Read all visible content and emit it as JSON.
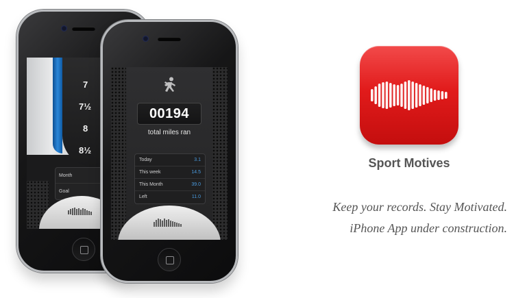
{
  "app": {
    "name": "Sport Motives",
    "tagline_1": "Keep your records. Stay Motivated.",
    "tagline_2": "iPhone App under construction.",
    "icon": "sound-wave-icon",
    "accent": "#e11b1b"
  },
  "back_phone": {
    "ruler": [
      "7",
      "7½",
      "8",
      "8½"
    ],
    "table": [
      {
        "label": "Month"
      },
      {
        "label": "Goal"
      }
    ]
  },
  "front_phone": {
    "icon": "runner-icon",
    "counter": "00194",
    "counter_label": "total miles ran",
    "stats": [
      {
        "label": "Today",
        "value": "3.1"
      },
      {
        "label": "This week",
        "value": "14.5"
      },
      {
        "label": "This Month",
        "value": "39.0"
      },
      {
        "label": "Left",
        "value": "11.0"
      }
    ],
    "value_color": "#4b9ce0"
  }
}
